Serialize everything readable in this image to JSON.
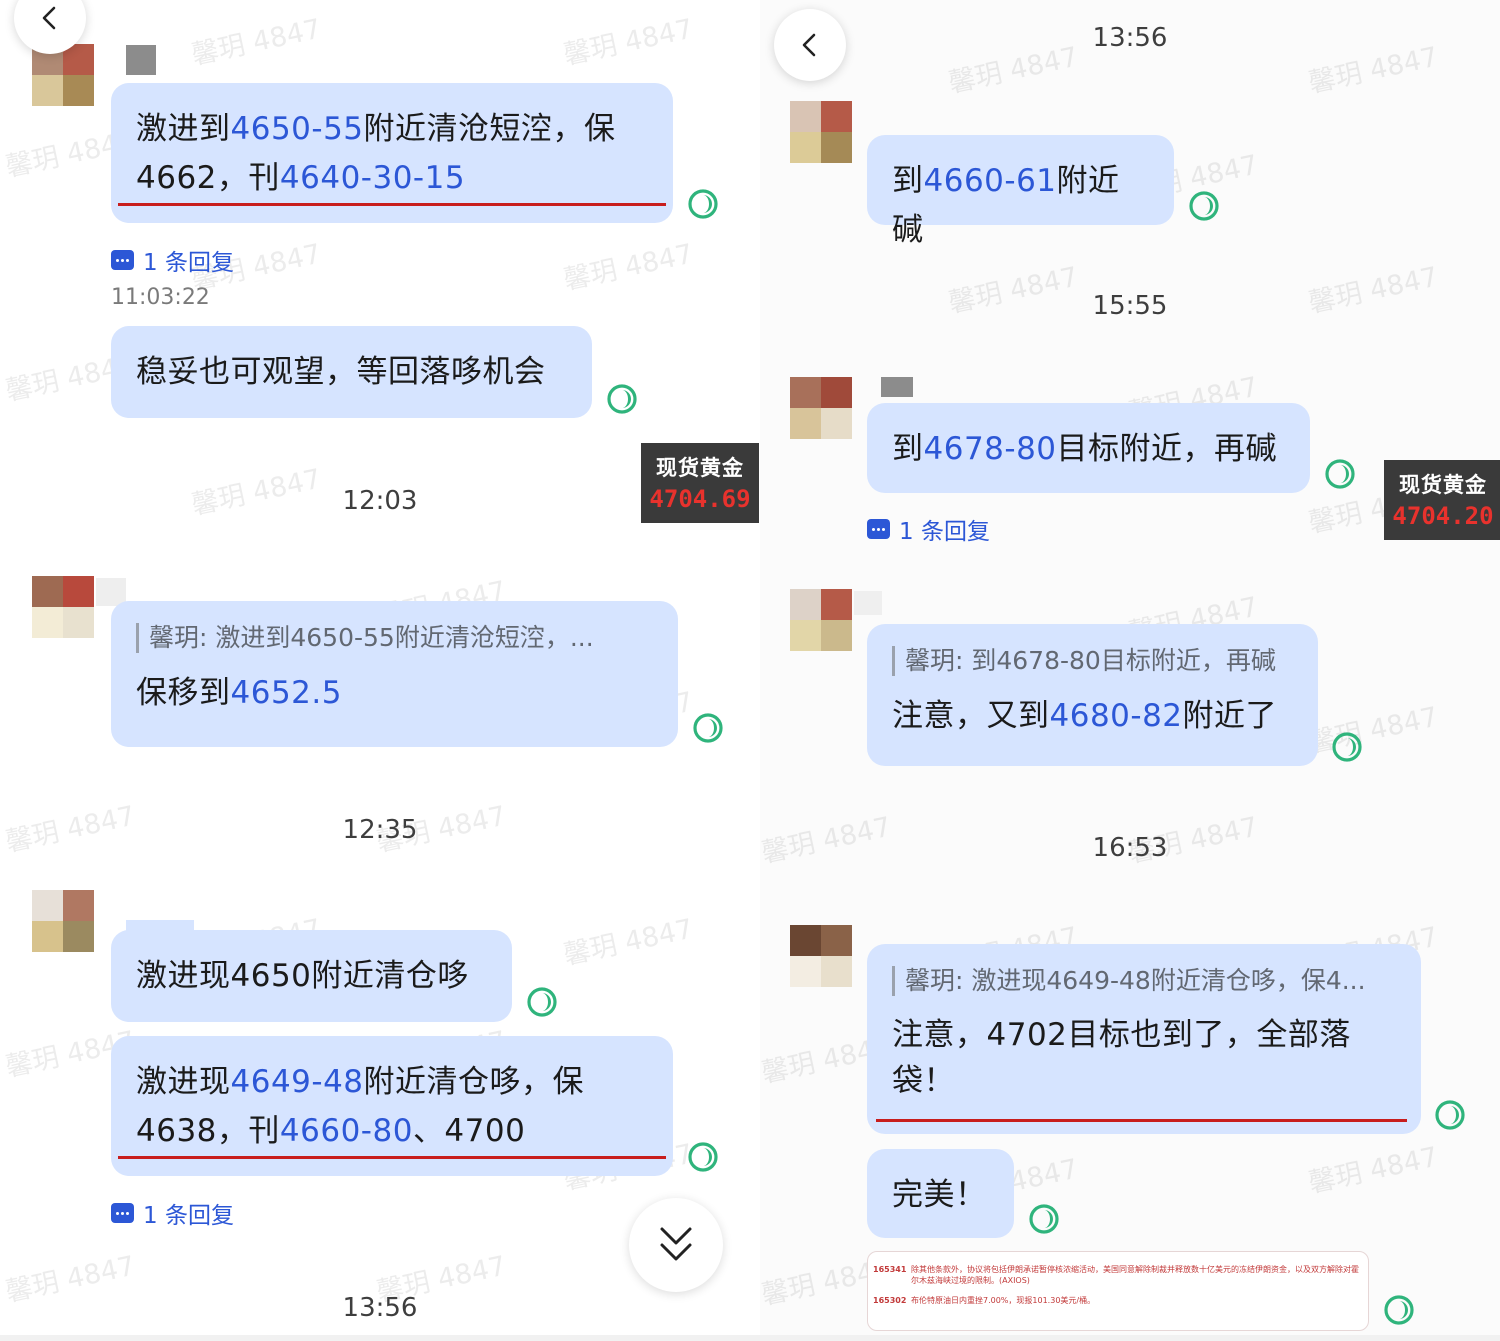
{
  "watermark": "馨玥 4847",
  "colors": {
    "bubble": "#d6e4ff",
    "highlight": "#2c57d6",
    "underline": "#c81d1d",
    "status": "#2fb47c",
    "ticker_bg": "#3a3a3a",
    "ticker_price": "#e8322d"
  },
  "icons": {
    "back": "chevron-left-icon",
    "status": "read-status-icon",
    "reply": "reply-bubble-icon",
    "scroll": "double-chevron-down-icon"
  },
  "left": {
    "msg1": {
      "p1": "激进到",
      "h1": "4650-55",
      "p2": "附近清沧短涳，保 4662，刊",
      "h2": "4640-30-15"
    },
    "reply1": "1 条回复",
    "ts1": "11:03:22",
    "msg2": "稳妥也可观望，等回落哆机会",
    "ticker": {
      "name": "现货黄金",
      "price": "4704.69"
    },
    "time1": "12:03",
    "msg3": {
      "quote": "馨玥: 激进到4650-55附近清沧短涳，...",
      "p1": "保移到",
      "h1": "4652.5"
    },
    "time2": "12:35",
    "msg4": "激进现4650附近清仓哆",
    "msg5": {
      "p1": "激进现",
      "h1": "4649-48",
      "p2": "附近清仓哆，保 4638，刊",
      "h2": "4660-80",
      "p3": "、4700"
    },
    "reply2": "1 条回复",
    "time3": "13:56"
  },
  "right": {
    "time1": "13:56",
    "msg1": {
      "p1": "到",
      "h1": "4660-61",
      "p2": "附近碱"
    },
    "time2": "15:55",
    "msg2": {
      "p1": "到",
      "h1": "4678-80",
      "p2": "目标附近，再碱"
    },
    "reply1": "1 条回复",
    "ticker": {
      "name": "现货黄金",
      "price": "4704.20"
    },
    "msg3": {
      "quote": "馨玥: 到4678-80目标附近，再碱",
      "p1": "注意，又到",
      "h1": "4680-82",
      "p2": "附近了"
    },
    "time3": "16:53",
    "msg4": {
      "quote": "馨玥: 激进现4649-48附近清仓哆，保4...",
      "text": "注意，4702目标也到了，全部落袋！"
    },
    "msg5": "完美！",
    "news": [
      {
        "time": "165341",
        "text": "除其他条款外，协议将包括伊朗承诺暂停核浓缩活动，美国同意解除制裁并释放数十亿美元的冻结伊朗资金，以及双方解除对霍尔木兹海峡过境的限制。(AXIOS)"
      },
      {
        "time": "165302",
        "text": "布伦特原油日内重挫7.00%，现报101.30美元/桶。"
      }
    ]
  }
}
